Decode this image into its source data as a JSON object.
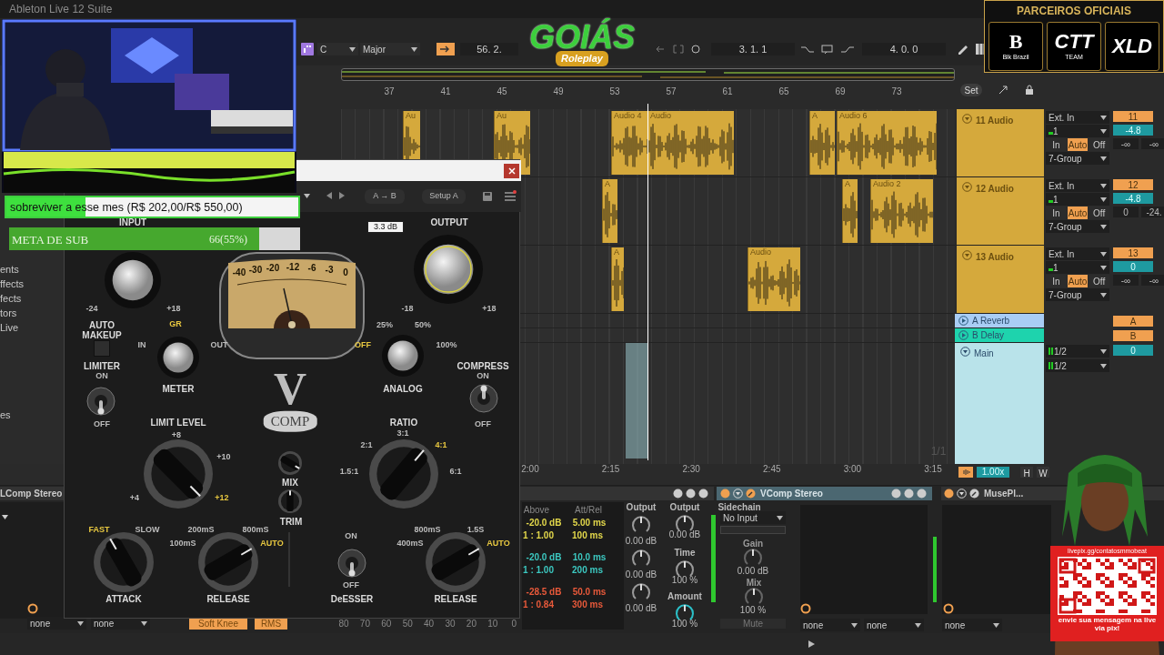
{
  "window": {
    "title": "Ableton Live 12 Suite"
  },
  "control_bar": {
    "key": "C",
    "scale": "Major",
    "position": "56. 2.",
    "loop_start": "3. 1. 1",
    "loop_length": "4. 0. 0"
  },
  "arrangement": {
    "bars": [
      "37",
      "41",
      "45",
      "49",
      "53",
      "57",
      "61",
      "65",
      "69",
      "73"
    ],
    "times": [
      "2:00",
      "2:15",
      "2:30",
      "2:45",
      "3:00",
      "3:15"
    ],
    "page": "1/1"
  },
  "browser": {
    "items": [
      "ents",
      "ffects",
      "fects",
      "tors",
      "Live",
      "es"
    ]
  },
  "tracks": [
    {
      "name": "11 Audio",
      "input": "Ext. In",
      "channel": "1",
      "monitor": [
        {
          "label": "In",
          "selected": false
        },
        {
          "label": "Auto",
          "selected": true
        },
        {
          "label": "Off",
          "selected": false
        }
      ],
      "output": "7-Group",
      "number": "11",
      "volume": "-4.8",
      "sends": [
        "-∞",
        "-∞"
      ],
      "clips": [
        "Au",
        "Au",
        "Audio 4",
        "Audio",
        "A",
        "Audio 6"
      ]
    },
    {
      "name": "12 Audio",
      "input": "Ext. In",
      "channel": "1",
      "monitor": [
        {
          "label": "In",
          "selected": false
        },
        {
          "label": "Auto",
          "selected": true
        },
        {
          "label": "Off",
          "selected": false
        }
      ],
      "output": "7-Group",
      "number": "12",
      "volume": "-4.8",
      "sends": [
        "0",
        "-24."
      ],
      "clips": [
        "A",
        "A",
        "Audio 2"
      ]
    },
    {
      "name": "13 Audio",
      "input": "Ext. In",
      "channel": "1",
      "monitor": [
        {
          "label": "In",
          "selected": false
        },
        {
          "label": "Auto",
          "selected": true
        },
        {
          "label": "Off",
          "selected": false
        }
      ],
      "output": "7-Group",
      "number": "13",
      "volume": "0",
      "sends": [
        "-∞",
        "-∞"
      ],
      "clips": [
        "A",
        "Audio"
      ]
    }
  ],
  "returns": [
    {
      "name": "A Reverb",
      "color": "#a9cdf5",
      "send": "A"
    },
    {
      "name": "B Delay",
      "color": "#1ed3ad",
      "send": "B"
    }
  ],
  "main": {
    "name": "Main",
    "inputs": [
      "1/2",
      "1/2"
    ],
    "volume": "0"
  },
  "view": {
    "set": "Set",
    "zoom": "1.00x",
    "buttons": [
      "H",
      "W"
    ]
  },
  "devices": {
    "left": {
      "title": "LComp Stereo",
      "selectors": [
        "none",
        "none"
      ],
      "buttons": [
        "Soft Knee",
        "RMS"
      ],
      "scale": [
        "80",
        "70",
        "60",
        "50",
        "40",
        "30",
        "20",
        "10",
        "0"
      ]
    },
    "multiband": {
      "headers": [
        "Above",
        "Att/Rel"
      ],
      "bands": [
        {
          "color": "#e3d84b",
          "threshold": "-20.0 dB",
          "ratio": "1 : 1.00",
          "attack": "5.00 ms",
          "release": "100 ms"
        },
        {
          "color": "#3cc8c0",
          "threshold": "-20.0 dB",
          "ratio": "1 : 1.00",
          "attack": "10.0 ms",
          "release": "200 ms"
        },
        {
          "color": "#e8593a",
          "threshold": "-28.5 dB",
          "ratio": "1 : 0.84",
          "attack": "50.0 ms",
          "release": "300 ms"
        }
      ],
      "gains": {
        "label": "Output",
        "values": [
          "0.00 dB",
          "0.00 dB",
          "0.00 dB"
        ]
      },
      "controls": [
        {
          "label": "Output",
          "value": "0.00 dB"
        },
        {
          "label": "Time",
          "value": "100 %"
        },
        {
          "label": "Amount",
          "value": "100 %"
        }
      ]
    },
    "vcomp": {
      "title": "VComp Stereo",
      "sidechain": "Sidechain",
      "source": "No Input",
      "gain_label": "Gain",
      "gain": "0.00 dB",
      "mix_label": "Mix",
      "mix": "100 %",
      "mute": "Mute",
      "selectors": [
        "none",
        "none"
      ]
    },
    "muse": {
      "title": "MusePl...",
      "selectors": [
        "none"
      ]
    }
  },
  "plugin": {
    "ab": "A → B",
    "preset": "Setup A",
    "readout": "3.3 dB",
    "vu_scale": [
      "-40",
      "-30",
      "-20",
      "-12",
      "-6",
      "-3",
      "0"
    ],
    "logo": {
      "letter": "V",
      "word": "COMP"
    },
    "controls": [
      {
        "kind": "knob",
        "label": "INPUT",
        "marks": [
          {
            "text": "-24",
            "selected": false
          },
          {
            "text": "+18",
            "selected": false
          }
        ]
      },
      {
        "kind": "knob",
        "label": "OUTPUT",
        "marks": [
          {
            "text": "-18",
            "selected": false
          },
          {
            "text": "+18",
            "selected": false
          }
        ]
      },
      {
        "kind": "button",
        "label": "AUTO MAKEUP"
      },
      {
        "kind": "knob",
        "label": "METER",
        "marks": [
          {
            "text": "GR",
            "selected": true
          },
          {
            "text": "IN",
            "selected": false
          },
          {
            "text": "OUT",
            "selected": false
          }
        ]
      },
      {
        "kind": "knob",
        "label": "ANALOG",
        "marks": [
          {
            "text": "25%",
            "selected": false
          },
          {
            "text": "50%",
            "selected": false
          },
          {
            "text": "OFF",
            "selected": true
          },
          {
            "text": "100%",
            "selected": false
          }
        ]
      },
      {
        "kind": "toggle",
        "label": "LIMITER",
        "on": false,
        "marks": [
          {
            "text": "ON",
            "selected": false
          },
          {
            "text": "OFF",
            "selected": false
          }
        ]
      },
      {
        "kind": "toggle",
        "label": "COMPRESS",
        "on": true,
        "marks": [
          {
            "text": "ON",
            "selected": false
          },
          {
            "text": "OFF",
            "selected": false
          }
        ]
      },
      {
        "kind": "knob",
        "label": "LIMIT LEVEL",
        "marks": [
          {
            "text": "+8",
            "selected": false
          },
          {
            "text": "+10",
            "selected": false
          },
          {
            "text": "+4",
            "selected": false
          },
          {
            "text": "+12",
            "selected": true
          }
        ]
      },
      {
        "kind": "knob",
        "label": "RATIO",
        "marks": [
          {
            "text": "3:1",
            "selected": false
          },
          {
            "text": "2:1",
            "selected": false
          },
          {
            "text": "4:1",
            "selected": true
          },
          {
            "text": "1.5:1",
            "selected": false
          },
          {
            "text": "6:1",
            "selected": false
          }
        ]
      },
      {
        "kind": "knob",
        "label": "MIX"
      },
      {
        "kind": "knob",
        "label": "TRIM"
      },
      {
        "kind": "knob",
        "label": "ATTACK",
        "marks": [
          {
            "text": "FAST",
            "selected": true
          },
          {
            "text": "SLOW",
            "selected": false
          }
        ]
      },
      {
        "kind": "knob",
        "label": "RELEASE",
        "marks": [
          {
            "text": "200mS",
            "selected": false
          },
          {
            "text": "800mS",
            "selected": false
          },
          {
            "text": "100mS",
            "selected": false
          },
          {
            "text": "AUTO",
            "selected": true
          }
        ]
      },
      {
        "kind": "toggle",
        "label": "DeESSER",
        "on": false,
        "marks": [
          {
            "text": "ON",
            "selected": false
          },
          {
            "text": "OFF",
            "selected": false
          }
        ]
      },
      {
        "kind": "knob",
        "label": "RELEASE",
        "marks": [
          {
            "text": "800mS",
            "selected": false
          },
          {
            "text": "1.5S",
            "selected": false
          },
          {
            "text": "400mS",
            "selected": false
          },
          {
            "text": "AUTO",
            "selected": true
          }
        ]
      }
    ]
  },
  "overlay": {
    "donation_goal": {
      "text": "sobreviver a esse mes (R$ 202,00/R$ 550,00)",
      "level": 0.27
    },
    "sub_goal": {
      "label": "META DE SUB",
      "value": "66(55%)",
      "level": 0.86
    },
    "logo": {
      "name": "GOIÁS",
      "tagline": "Roleplay"
    },
    "partners": {
      "title": "PARCEIROS OFICIAIS",
      "logos": [
        {
          "text": "B",
          "caption": "Blk Brazil"
        },
        {
          "text": "CTT",
          "caption": "TEAM"
        },
        {
          "text": "XLD"
        }
      ]
    },
    "qr": {
      "url": "livepix.gg/contatosmmobeat",
      "message": "envie sua mensagem na live via pix!"
    }
  }
}
